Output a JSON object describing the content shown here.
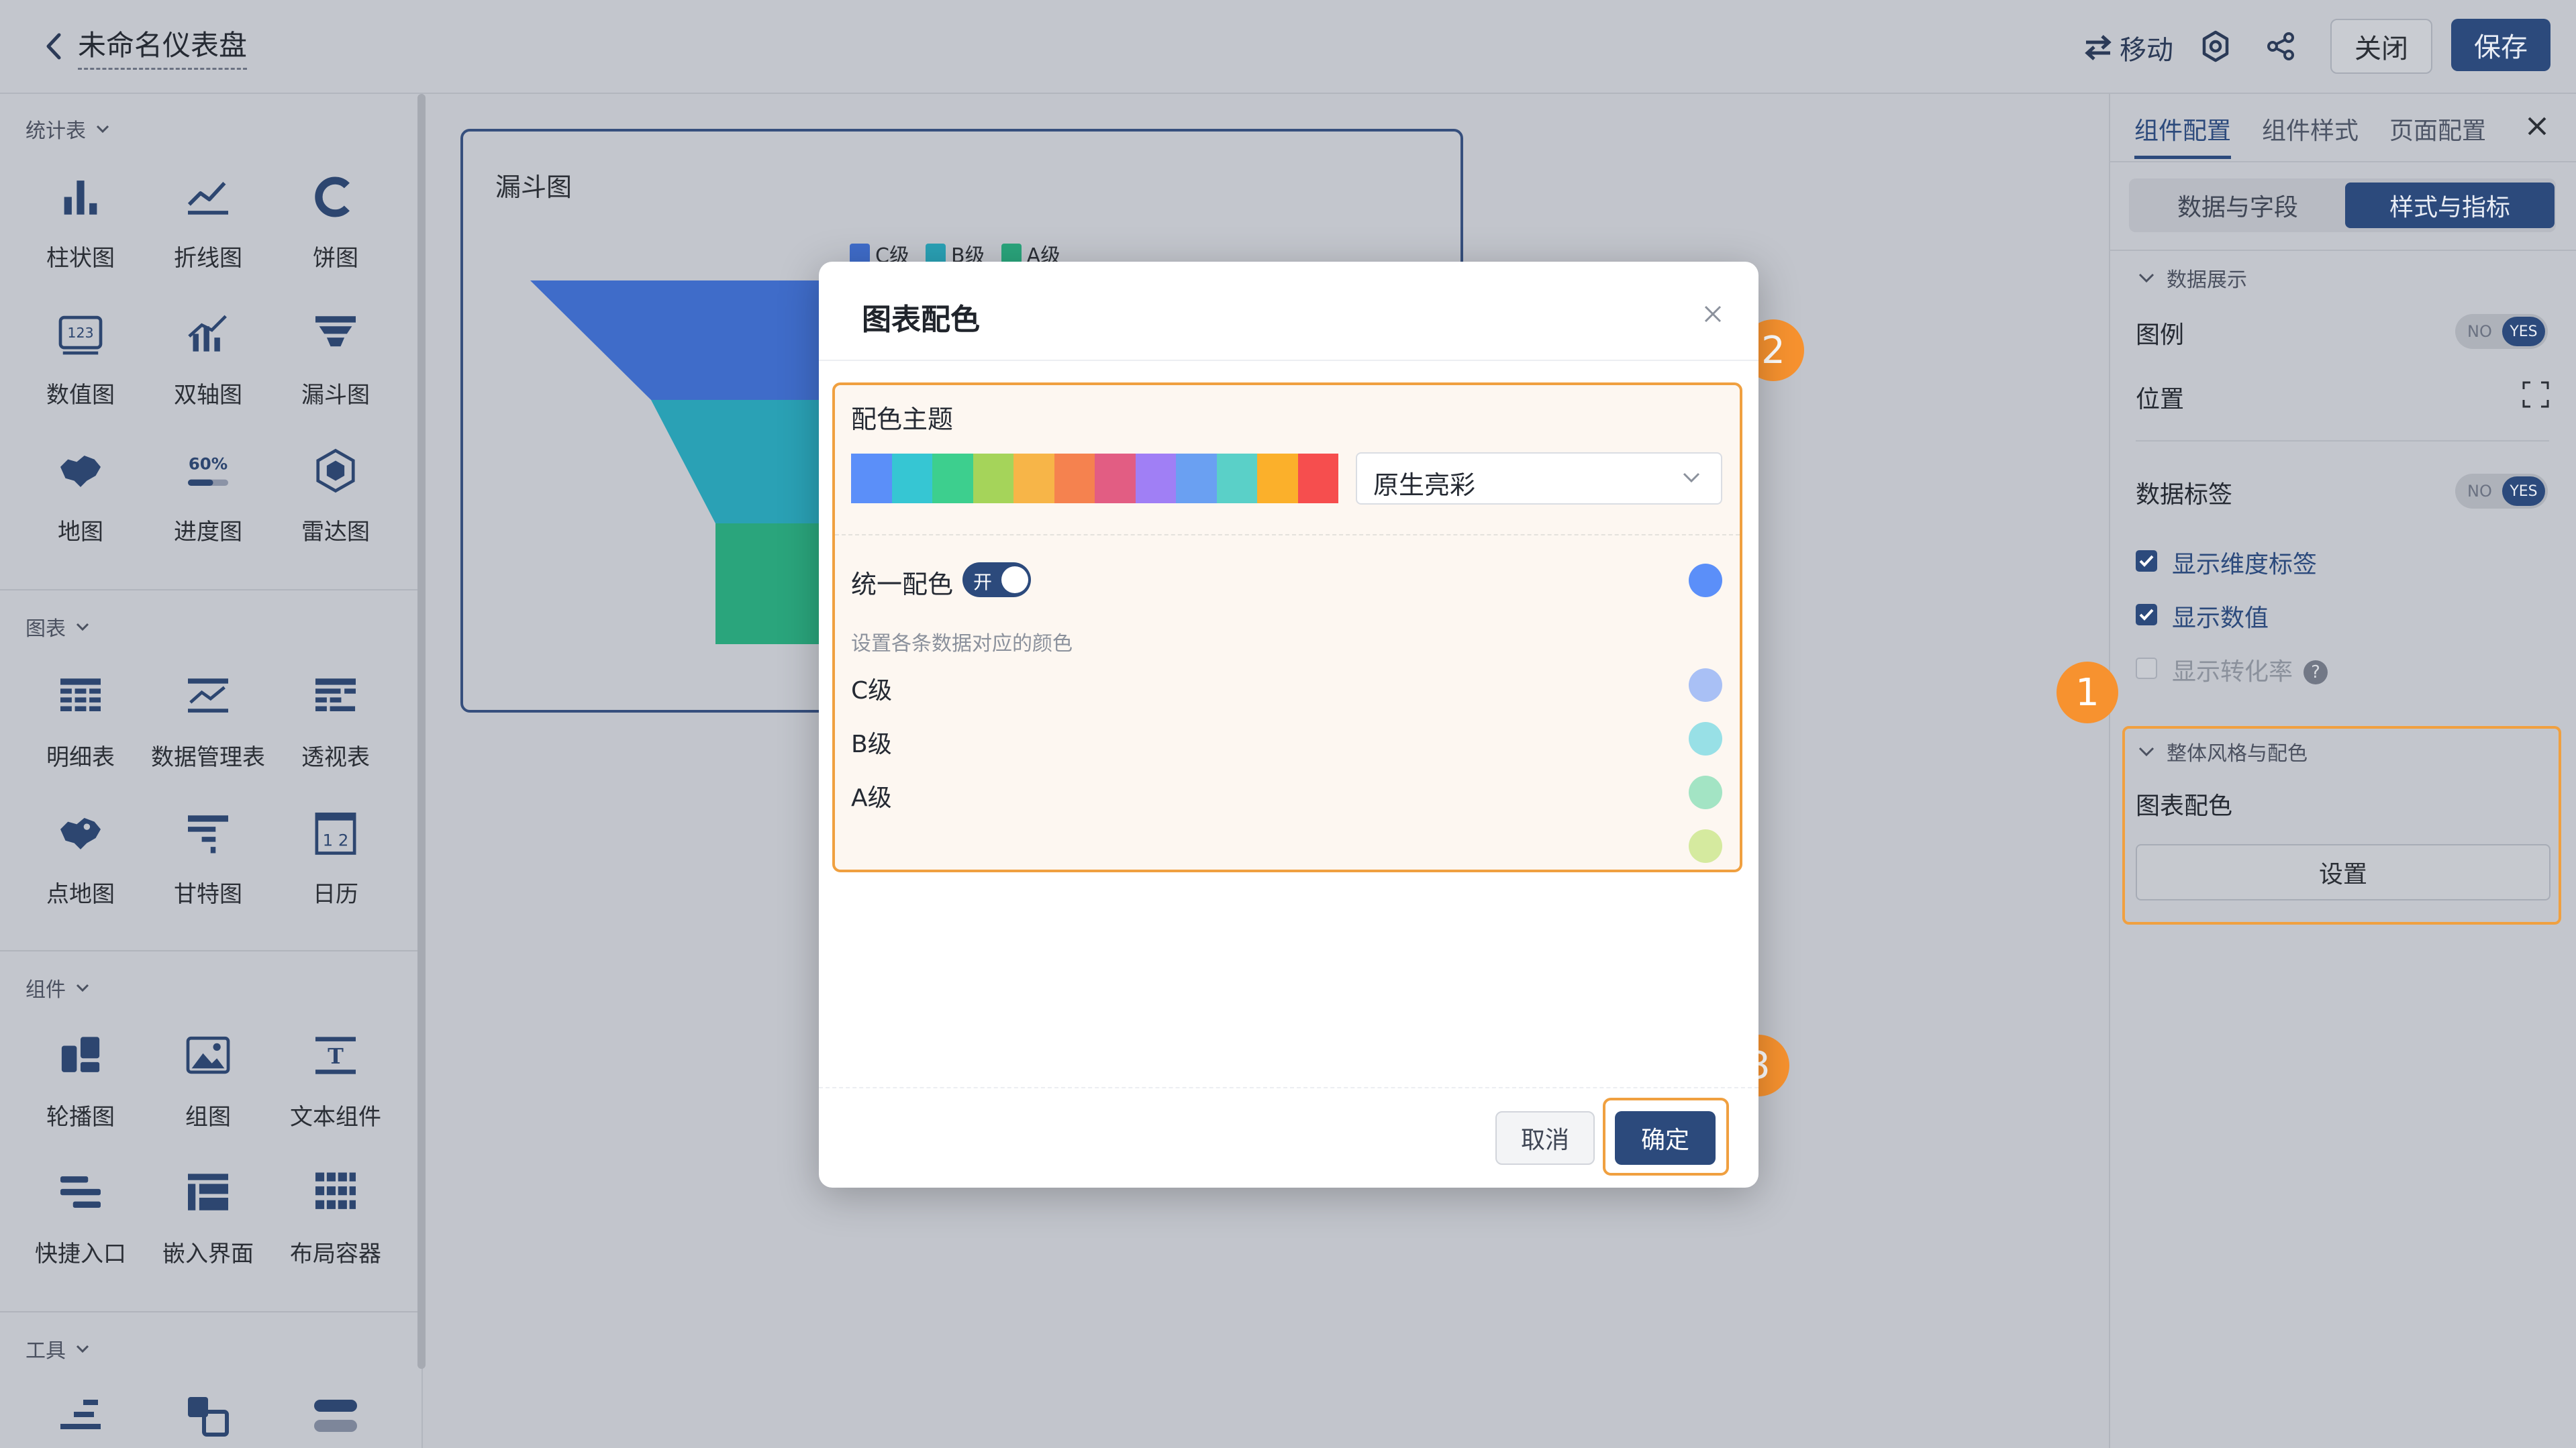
{
  "header": {
    "title": "未命名仪表盘",
    "move_label": "移动",
    "close_label": "关闭",
    "save_label": "保存"
  },
  "sidebar": {
    "sections": [
      {
        "title": "统计表",
        "items": [
          {
            "label": "柱状图",
            "icon": "bar-chart-icon"
          },
          {
            "label": "折线图",
            "icon": "line-chart-icon"
          },
          {
            "label": "饼图",
            "icon": "pie-chart-icon"
          },
          {
            "label": "数值图",
            "icon": "number-chart-icon"
          },
          {
            "label": "双轴图",
            "icon": "dual-axis-chart-icon"
          },
          {
            "label": "漏斗图",
            "icon": "funnel-chart-icon"
          },
          {
            "label": "地图",
            "icon": "map-icon"
          },
          {
            "label": "进度图",
            "icon": "progress-chart-icon"
          },
          {
            "label": "雷达图",
            "icon": "radar-chart-icon"
          }
        ]
      },
      {
        "title": "图表",
        "items": [
          {
            "label": "明细表",
            "icon": "detail-table-icon"
          },
          {
            "label": "数据管理表",
            "icon": "data-table-icon"
          },
          {
            "label": "透视表",
            "icon": "pivot-table-icon"
          },
          {
            "label": "点地图",
            "icon": "dot-map-icon"
          },
          {
            "label": "甘特图",
            "icon": "gantt-chart-icon"
          },
          {
            "label": "日历",
            "icon": "calendar-icon"
          }
        ]
      },
      {
        "title": "组件",
        "items": [
          {
            "label": "轮播图",
            "icon": "carousel-icon"
          },
          {
            "label": "组图",
            "icon": "image-group-icon"
          },
          {
            "label": "文本组件",
            "icon": "text-component-icon"
          },
          {
            "label": "快捷入口",
            "icon": "shortcut-icon"
          },
          {
            "label": "嵌入界面",
            "icon": "embed-icon"
          },
          {
            "label": "布局容器",
            "icon": "layout-container-icon"
          }
        ]
      },
      {
        "title": "工具",
        "items": []
      }
    ],
    "progress_icon_text": "60%",
    "number_icon_text": "123",
    "calendar_icon_text": "1 2"
  },
  "widget": {
    "title": "漏斗图",
    "legend": [
      "C级",
      "B级",
      "A级"
    ],
    "colors": [
      "#3f6cc9",
      "#2aa1b5",
      "#2aa57c"
    ]
  },
  "right_panel": {
    "tabs": [
      "组件配置",
      "组件样式",
      "页面配置"
    ],
    "segments": [
      "数据与字段",
      "样式与指标"
    ],
    "data_display": "数据展示",
    "legend_label": "图例",
    "position_label": "位置",
    "data_label": "数据标签",
    "toggle_no": "NO",
    "toggle_yes": "YES",
    "checkboxes": [
      {
        "label": "显示维度标签",
        "checked": true
      },
      {
        "label": "显示数值",
        "checked": true
      },
      {
        "label": "显示转化率",
        "checked": false
      }
    ],
    "help_icon_text": "?",
    "style_section": "整体风格与配色",
    "chart_color_label": "图表配色",
    "setup_label": "设置"
  },
  "markers": [
    "1",
    "2",
    "3"
  ],
  "modal": {
    "title": "图表配色",
    "theme_label": "配色主题",
    "theme_colors": [
      "#5b8ff9",
      "#36c6d3",
      "#3dcf8e",
      "#a5d45a",
      "#f7b548",
      "#f5824f",
      "#e25d83",
      "#a07ff5",
      "#6aa0f2",
      "#5ad0c8",
      "#fbb02b",
      "#f64e4e"
    ],
    "theme_value": "原生亮彩",
    "unify_label": "统一配色",
    "unify_toggle_text": "开",
    "unify_color": "#5b8ff9",
    "hint": "设置各条数据对应的颜色",
    "series": [
      {
        "label": "C级",
        "color": "#a9c0f5"
      },
      {
        "label": "B级",
        "color": "#98e0e6"
      },
      {
        "label": "A级",
        "color": "#a3e4c4"
      },
      {
        "label": "",
        "color": "#d5ea9f"
      }
    ],
    "cancel_label": "取消",
    "ok_label": "确定"
  }
}
